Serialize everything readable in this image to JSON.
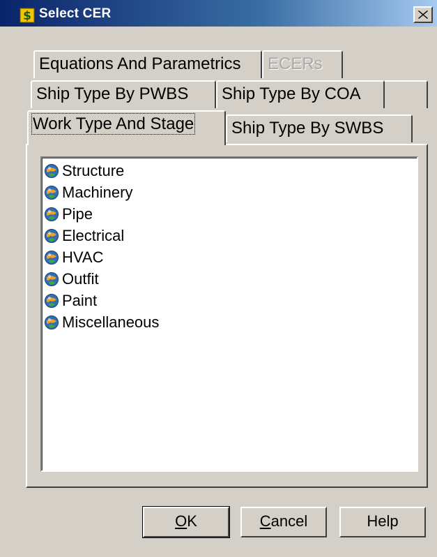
{
  "window": {
    "title": "Select CER",
    "close_glyph": "✕",
    "icon": "dollar-icon"
  },
  "tabs": {
    "row1": [
      {
        "label": "Equations And Parametrics",
        "disabled": false
      },
      {
        "label": "ECERs",
        "disabled": true
      }
    ],
    "row2": [
      {
        "label": "Ship Type By PWBS"
      },
      {
        "label": "Ship Type By COA"
      }
    ],
    "row3": [
      {
        "label": "Work Type And Stage",
        "active": true
      },
      {
        "label": "Ship Type By SWBS"
      }
    ]
  },
  "tree": {
    "item_icon": "globe-cer-icon",
    "items": [
      {
        "label": "Structure"
      },
      {
        "label": "Machinery"
      },
      {
        "label": "Pipe"
      },
      {
        "label": "Electrical"
      },
      {
        "label": "HVAC"
      },
      {
        "label": "Outfit"
      },
      {
        "label": "Paint"
      },
      {
        "label": "Miscellaneous"
      }
    ]
  },
  "buttons": {
    "ok": {
      "mnemonic": "O",
      "rest": "K"
    },
    "cancel": {
      "mnemonic": "C",
      "rest": "ancel"
    },
    "help": {
      "label": "Help"
    }
  }
}
